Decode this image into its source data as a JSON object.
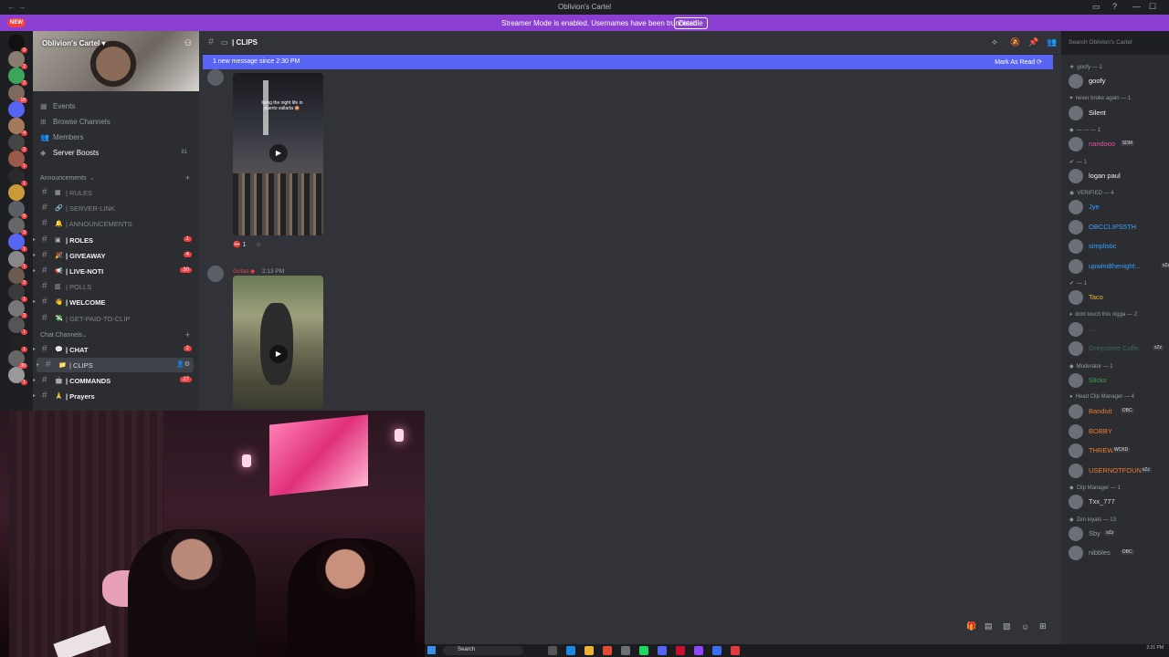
{
  "window": {
    "title": "Oblivion's Cartel",
    "new_badge": "NEW",
    "nav_glyph": "←  →"
  },
  "streamer_bar": {
    "text": "Streamer Mode is enabled. Usernames have been truncated.",
    "button": "Disable"
  },
  "guild_badges": [
    "6",
    "2",
    "2",
    "18",
    "",
    "4",
    "2",
    "1",
    "1",
    "",
    "6",
    "3",
    "1",
    "1",
    "2",
    "1",
    "2",
    "1",
    "1",
    "30",
    "1"
  ],
  "sidebar": {
    "server_name": "Oblivion's Cartel",
    "items": [
      {
        "label": "Events",
        "icon": "calendar-icon"
      },
      {
        "label": "Browse Channels",
        "icon": "browse-icon"
      },
      {
        "label": "Members",
        "icon": "members-icon"
      },
      {
        "label": "Server Boosts",
        "icon": "boost-icon",
        "count": "81"
      }
    ],
    "categories": [
      {
        "label": "Announcements",
        "channels": [
          {
            "name": "| RULES",
            "emoji": "▦",
            "state": "muted"
          },
          {
            "name": "| SERVER-LINK",
            "emoji": "🔗",
            "state": "muted"
          },
          {
            "name": "| ANNOUNCEMENTS",
            "emoji": "🔔",
            "state": "muted"
          },
          {
            "name": "| ROLES",
            "emoji": "▣",
            "state": "unread",
            "count": "1"
          },
          {
            "name": "| GIVEAWAY",
            "emoji": "🎉",
            "state": "unread",
            "count": "4"
          },
          {
            "name": "| LIVE-NOTI",
            "emoji": "📢",
            "state": "unread",
            "count": "30"
          },
          {
            "name": "| POLLS",
            "emoji": "▥",
            "state": "muted"
          },
          {
            "name": "| WELCOME",
            "emoji": "👋",
            "state": "unread"
          },
          {
            "name": "| GET-PAID-TO-CLIP",
            "emoji": "💸",
            "state": "muted"
          }
        ]
      },
      {
        "label": "Chat Channels",
        "channels": [
          {
            "name": "| CHAT",
            "emoji": "💬",
            "state": "unread",
            "count": "2"
          },
          {
            "name": "| CLIPS",
            "emoji": "📁",
            "state": "active"
          },
          {
            "name": "| COMMANDS",
            "emoji": "🤖",
            "state": "unread",
            "count": "27"
          },
          {
            "name": "| Prayers",
            "emoji": "🙏",
            "state": "unread"
          }
        ]
      }
    ]
  },
  "channel": {
    "name": "| CLIPS",
    "new_message_bar": "1 new message since 2:30 PM",
    "mark_as_read": "Mark As Read",
    "search_placeholder": "Search Oblivion's Cartel"
  },
  "messages": [
    {
      "video_caption": "living the night life in puerto vallarta 🎇",
      "reaction_count": "1"
    },
    {
      "author": "Gotas",
      "time": "2:13 PM"
    }
  ],
  "members": [
    {
      "role": "goofy — 1",
      "people": [
        {
          "name": "goofy",
          "color": "#f2f3f5"
        }
      ]
    },
    {
      "role": "never broke again — 1",
      "people": [
        {
          "name": "Silent",
          "color": "#f2f3f5"
        }
      ]
    },
    {
      "role": "— — — 1",
      "people": [
        {
          "name": "nandooo",
          "color": "#e84fa8",
          "tag": "SDM"
        }
      ]
    },
    {
      "role": "— 1",
      "people": [
        {
          "name": "logan paul",
          "color": "#f2f3f5"
        }
      ]
    },
    {
      "role": "VERIFIED — 4",
      "people": [
        {
          "name": "Jye",
          "color": "#3ba0ff"
        },
        {
          "name": "OBCCLIPS5TH",
          "color": "#3ba0ff"
        },
        {
          "name": "simplistic",
          "color": "#3ba0ff"
        },
        {
          "name": "upwindthenight...",
          "color": "#3ba0ff",
          "tag": "xZz"
        }
      ]
    },
    {
      "role": "— 1",
      "people": [
        {
          "name": "Taco",
          "color": "#f0b232"
        }
      ]
    },
    {
      "role": "dont touch this nigga — 2",
      "people": [
        {
          "name": "...",
          "color": "#5c5e66"
        },
        {
          "name": "Greycorne Coffe",
          "color": "#3a6b5a",
          "tag": "xZz"
        }
      ]
    },
    {
      "role": "Moderator — 1",
      "people": [
        {
          "name": "Slicks",
          "color": "#43a25a"
        }
      ]
    },
    {
      "role": "Head Clip Manager — 4",
      "people": [
        {
          "name": "Bandoit",
          "color": "#f07a2e",
          "tag": "OBC"
        },
        {
          "name": "BOBBY",
          "color": "#f07a2e"
        },
        {
          "name": "THREW",
          "color": "#f07a2e",
          "tag": "WCKD"
        },
        {
          "name": "USERNOTFOUND",
          "color": "#f07a2e",
          "tag": "xZz"
        }
      ]
    },
    {
      "role": "Clip Manager — 1",
      "people": [
        {
          "name": "Txx_777",
          "color": "#dbdee1"
        }
      ]
    },
    {
      "role": "Zen loyals — 13",
      "people": [
        {
          "name": "Sby",
          "color": "#949ba4",
          "tag": "xZz"
        },
        {
          "name": "nibbles",
          "color": "#949ba4",
          "tag": "OBC"
        }
      ]
    }
  ],
  "taskbar": {
    "search": "Search",
    "time": "2:31 PM"
  }
}
